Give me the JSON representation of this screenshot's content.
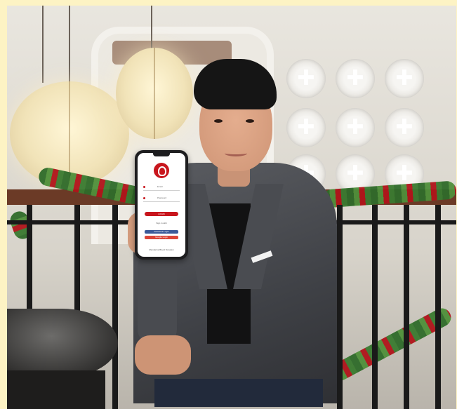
{
  "photo": {
    "subject": "person holding smartphone",
    "frame_color": "#fdf3c4"
  },
  "phone_app": {
    "accent_color": "#c8161d",
    "logo_icon": "drop-logo-icon",
    "username_placeholder": "Email",
    "password_placeholder": "Password",
    "login_label": "LOGIN",
    "or_label": "Sign in with",
    "facebook_label": "Facebook Login",
    "google_label": "Google Login",
    "footer_text": "Mandarina Blood Donation"
  }
}
